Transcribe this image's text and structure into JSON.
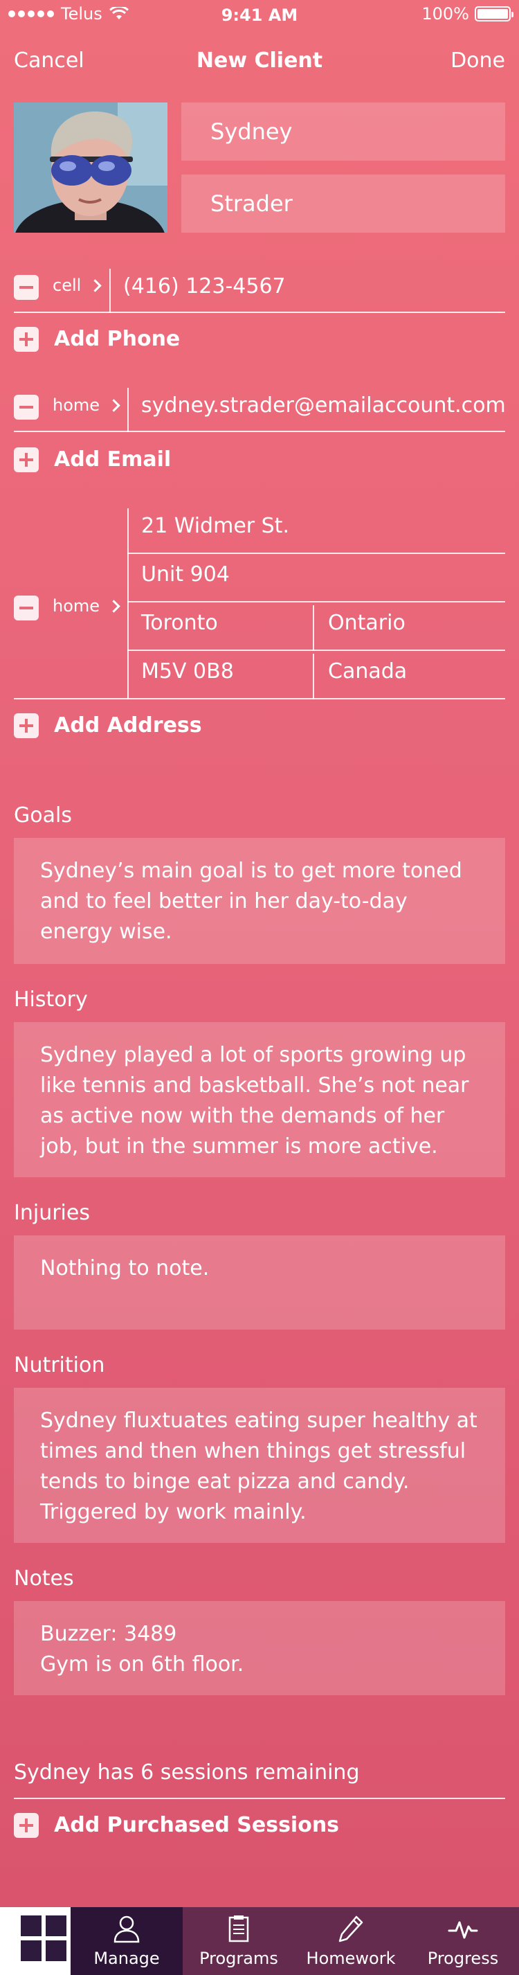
{
  "status_bar": {
    "carrier": "Telus",
    "time": "9:41 AM",
    "battery": "100%"
  },
  "nav": {
    "cancel": "Cancel",
    "title": "New Client",
    "done": "Done"
  },
  "client": {
    "first_name": "Sydney",
    "last_name": "Strader"
  },
  "phone": {
    "type": "cell",
    "value": "(416) 123-4567",
    "add_label": "Add Phone"
  },
  "email": {
    "type": "home",
    "value": "sydney.strader@emailaccount.com",
    "add_label": "Add Email"
  },
  "address": {
    "type": "home",
    "street": "21 Widmer St.",
    "unit": "Unit 904",
    "city": "Toronto",
    "province": "Ontario",
    "postal": "M5V 0B8",
    "country": "Canada",
    "add_label": "Add Address"
  },
  "sections": {
    "goals": {
      "title": "Goals",
      "text": "Sydney’s main goal is to get more toned\nand to feel better in her day-to-day\nenergy wise."
    },
    "history": {
      "title": "History",
      "text": "Sydney played a lot of sports growing up\nlike tennis and basketball. She’s not near\nas active now with the demands of her\njob, but in the summer is more active."
    },
    "injuries": {
      "title": "Injuries",
      "text": "Nothing to note."
    },
    "nutrition": {
      "title": "Nutrition",
      "text": "Sydney fluxtuates eating super healthy at\ntimes and then when things get stressful\ntends to binge eat pizza and candy.\nTriggered by work mainly."
    },
    "notes": {
      "title": "Notes",
      "text": "Buzzer: 3489\nGym is on 6th floor."
    }
  },
  "sessions": {
    "remaining_text": "Sydney has 6 sessions remaining",
    "add_label": "Add Purchased Sessions"
  },
  "tabbar": {
    "tabs": [
      {
        "label": "Manage",
        "icon": "user-icon",
        "active": true
      },
      {
        "label": "Programs",
        "icon": "clipboard-icon",
        "active": false
      },
      {
        "label": "Homework",
        "icon": "pencil-icon",
        "active": false
      },
      {
        "label": "Progress",
        "icon": "pulse-icon",
        "active": false
      }
    ]
  },
  "colors": {
    "background_top": "#ef6e7b",
    "background_bottom": "#d9536d",
    "tab_active": "#2b1436",
    "tab_inactive": "#642b4e"
  }
}
